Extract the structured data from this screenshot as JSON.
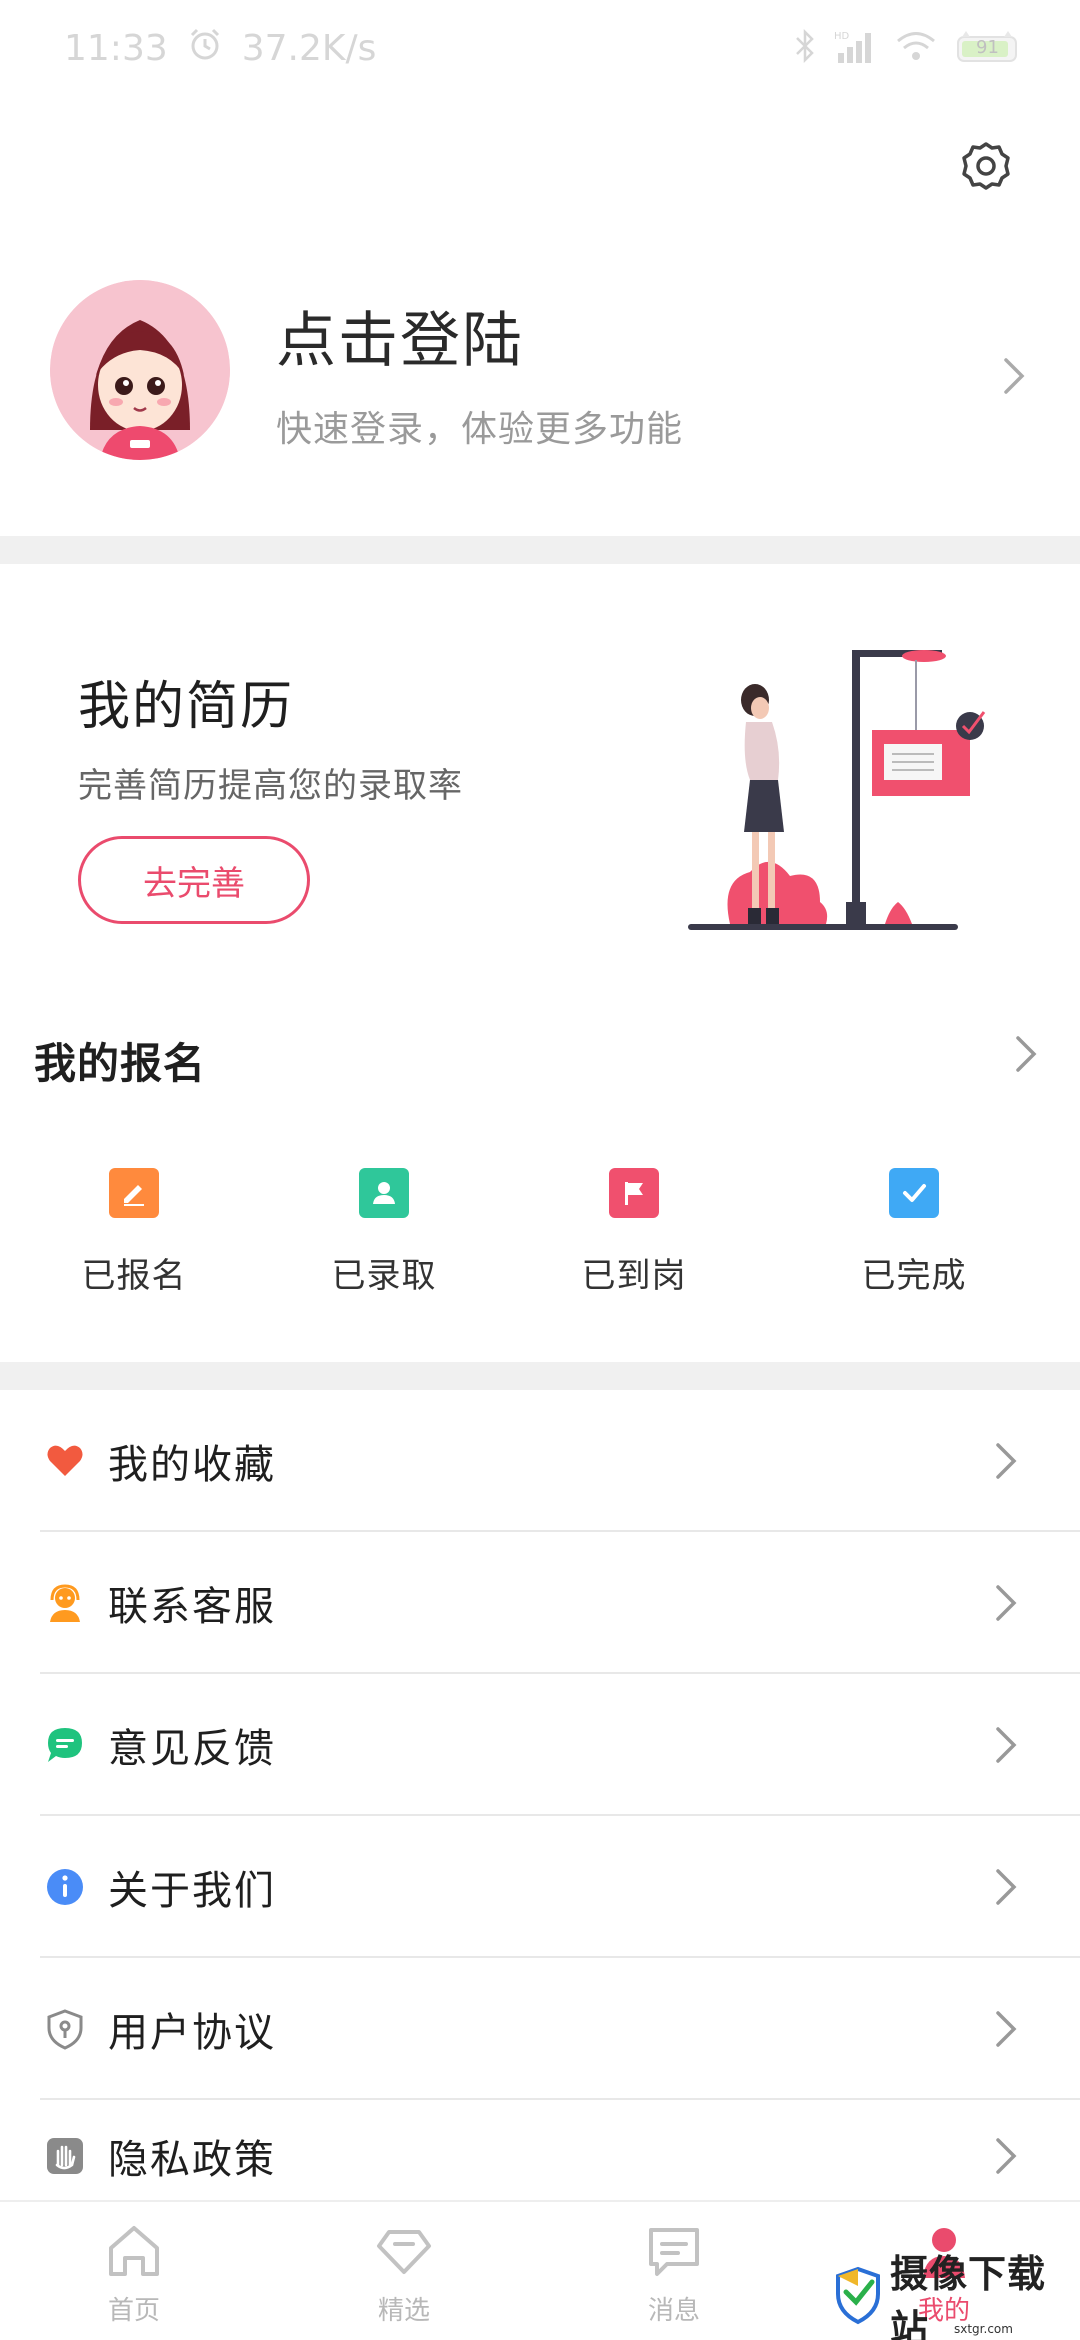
{
  "status_bar": {
    "time": "11:33",
    "speed": "37.2K/s",
    "battery": "91"
  },
  "profile": {
    "title": "点击登陆",
    "subtitle": "快速登录，体验更多功能"
  },
  "resume": {
    "title": "我的简历",
    "subtitle": "完善简历提高您的录取率",
    "button_label": "去完善"
  },
  "signups": {
    "title": "我的报名",
    "items": [
      {
        "label": "已报名",
        "icon": "edit-icon",
        "color": "#ff8a3d"
      },
      {
        "label": "已录取",
        "icon": "person-icon",
        "color": "#2fc79a"
      },
      {
        "label": "已到岗",
        "icon": "flag-icon",
        "color": "#f0506e"
      },
      {
        "label": "已完成",
        "icon": "check-icon",
        "color": "#3fa9f5"
      }
    ]
  },
  "menu": [
    {
      "label": "我的收藏",
      "icon": "heart-icon",
      "color": "#f25a3f"
    },
    {
      "label": "联系客服",
      "icon": "customer-service-icon",
      "color": "#ff9a1f"
    },
    {
      "label": "意见反馈",
      "icon": "chat-bubble-icon",
      "color": "#1fc37e"
    },
    {
      "label": "关于我们",
      "icon": "info-icon",
      "color": "#4a8cf7"
    },
    {
      "label": "用户协议",
      "icon": "shield-icon",
      "color": "#8a8a8a"
    },
    {
      "label": "隐私政策",
      "icon": "hand-icon",
      "color": "#8a8a8a"
    }
  ],
  "bottom_nav": [
    {
      "label": "首页",
      "icon": "home-icon"
    },
    {
      "label": "精选",
      "icon": "diamond-icon"
    },
    {
      "label": "消息",
      "icon": "message-icon"
    },
    {
      "label": "我的",
      "icon": "user-icon",
      "active": true
    }
  ],
  "watermark": {
    "text": "摄像下载站",
    "url": "sxtgr.com"
  },
  "colors": {
    "accent": "#ea4b6d",
    "divider": "#f0f0f0"
  }
}
